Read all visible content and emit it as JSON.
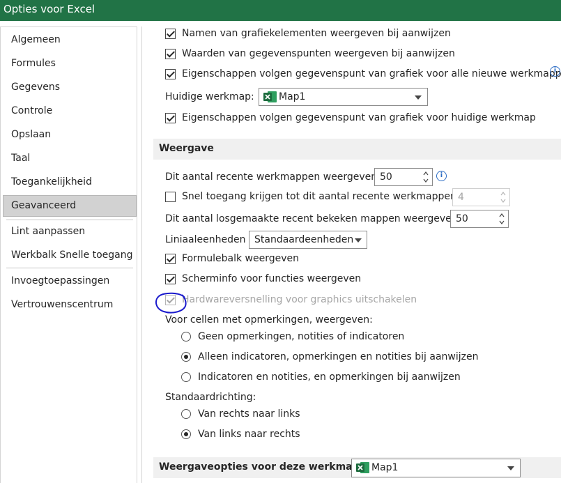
{
  "window": {
    "title": "Opties voor Excel"
  },
  "sidebar": {
    "items": [
      {
        "label": "Algemeen"
      },
      {
        "label": "Formules"
      },
      {
        "label": "Gegevens"
      },
      {
        "label": "Controle"
      },
      {
        "label": "Opslaan"
      },
      {
        "label": "Taal"
      },
      {
        "label": "Toegankelijkheid"
      },
      {
        "label": "Geavanceerd",
        "selected": true
      },
      {
        "label": "Lint aanpassen"
      },
      {
        "label": "Werkbalk Snelle toegang"
      },
      {
        "label": "Invoegtoepassingen"
      },
      {
        "label": "Vertrouwenscentrum"
      }
    ]
  },
  "chart_options": {
    "names_on_hover": {
      "label": "Namen van grafiekelementen weergeven bij aanwijzen",
      "checked": true
    },
    "values_on_hover": {
      "label": "Waarden van gegevenspunten weergeven bij aanwijzen",
      "checked": true
    },
    "props_all_new": {
      "label": "Eigenschappen volgen gegevenspunt van grafiek voor alle nieuwe werkmappen",
      "checked": true
    },
    "current_workbook_label": "Huidige werkmap:",
    "current_workbook_value": "Map1",
    "props_current": {
      "label": "Eigenschappen volgen gegevenspunt van grafiek voor huidige werkmap",
      "checked": true
    }
  },
  "display": {
    "section_title": "Weergave",
    "recent_workbooks_label": "Dit aantal recente werkmappen weergeven:",
    "recent_workbooks_value": "50",
    "quick_access": {
      "label": "Snel toegang krijgen tot dit aantal recente werkmappen:",
      "checked": false,
      "value": "4"
    },
    "unpinned_folders_label": "Dit aantal losgemaakte recent bekeken mappen weergeven:",
    "unpinned_folders_value": "50",
    "ruler_units_label": "Liniaaleenheden",
    "ruler_units_value": "Standaardeenheden",
    "formula_bar": {
      "label": "Formulebalk weergeven",
      "checked": true
    },
    "screentips": {
      "label": "Scherminfo voor functies weergeven",
      "checked": true
    },
    "hw_acceleration": {
      "label": "Hardwareversnelling voor graphics uitschakelen",
      "checked": true,
      "disabled": true
    },
    "comments_label": "Voor cellen met opmerkingen, weergeven:",
    "comments_options": [
      {
        "label": "Geen opmerkingen, notities of indicatoren",
        "selected": false
      },
      {
        "label": "Alleen indicatoren, opmerkingen en notities bij aanwijzen",
        "selected": true
      },
      {
        "label": "Indicatoren en notities, en opmerkingen bij aanwijzen",
        "selected": false
      }
    ],
    "direction_label": "Standaardrichting:",
    "direction_options": [
      {
        "label": "Van rechts naar links",
        "selected": false
      },
      {
        "label": "Van links naar rechts",
        "selected": true
      }
    ]
  },
  "workbook_display": {
    "section_title": "Weergaveopties voor deze werkmap:",
    "workbook_value": "Map1"
  },
  "colors": {
    "titlebar": "#217346",
    "section_bg": "#f0f0f0",
    "selected_bg": "#d2d2d2",
    "info_icon": "#2b6cc4",
    "annotation": "#1a1acc"
  }
}
